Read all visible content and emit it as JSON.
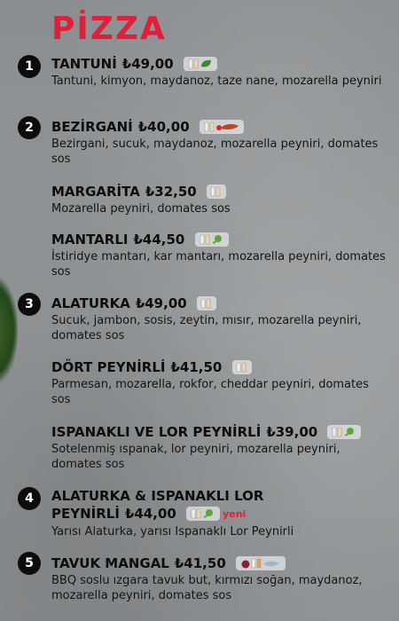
{
  "title": "PİZZA",
  "items": [
    {
      "number": "1",
      "name": "TANTUNİ",
      "price": "₺49,00",
      "desc": "Tantuni, kimyon, maydanoz, taze nane, mozarella peyniri",
      "icons": [
        "sauce-bottle-icon",
        "leaf-icon"
      ]
    },
    {
      "number": "2",
      "name": "BEZİRGANİ",
      "price": "₺40,00",
      "desc": "Bezirgani, sucuk, maydanoz, mozarella peyniri, domates sos",
      "icons": [
        "sauce-bottle-icon",
        "sausage-icon"
      ]
    },
    {
      "number": "",
      "name": "MARGARİTA",
      "price": "₺32,50",
      "desc": "Mozarella peyniri, domates sos",
      "icons": [
        "sauce-bottle-icon"
      ]
    },
    {
      "number": "",
      "name": "MANTARLI",
      "price": "₺44,50",
      "desc": "İstiridye mantarı, kar mantarı, mozarella peyniri, domates sos",
      "icons": [
        "sauce-bottle-icon",
        "mushroom-icon"
      ]
    },
    {
      "number": "3",
      "name": "ALATURKA",
      "price": "₺49,00",
      "desc": "Sucuk, jambon, sosis, zeytin, mısır, mozarella peyniri, domates sos",
      "icons": [
        "sauce-bottle-icon"
      ]
    },
    {
      "number": "",
      "name": "DÖRT PEYNİRLİ",
      "price": "₺41,50",
      "desc": "Parmesan, mozarella, rokfor, cheddar peyniri, domates sos",
      "icons": [
        "sauce-bottle-icon"
      ]
    },
    {
      "number": "",
      "name": "ISPANAKLI VE LOR PEYNİRLİ",
      "price": "₺39,00",
      "desc": "Sotelenmiş ıspanak, lor peyniri, mozarella peyniri, domates sos",
      "icons": [
        "sauce-bottle-icon",
        "mushroom-icon"
      ]
    },
    {
      "number": "4",
      "name_line1": "ALATURKA & ISPANAKLI LOR",
      "name": "PEYNİRLİ",
      "price": "₺44,00",
      "tag": "yeni",
      "desc": "Yarısı Alaturka, yarısı Ispanaklı Lor Peynirli",
      "icons": [
        "sauce-bottle-icon",
        "mushroom-icon"
      ]
    },
    {
      "number": "5",
      "name": "TAVUK MANGAL",
      "price": "₺41,50",
      "desc": "BBQ soslu ızgara tavuk but, kırmızı soğan, maydanoz, mozarella peyniri, domates sos",
      "icons": [
        "onion-icon",
        "sauce-bottle-icon",
        "chicken-icon"
      ]
    }
  ],
  "colors": {
    "title": "#e0203a",
    "badge": "#0c0c0c",
    "tag": "#e0203a"
  }
}
